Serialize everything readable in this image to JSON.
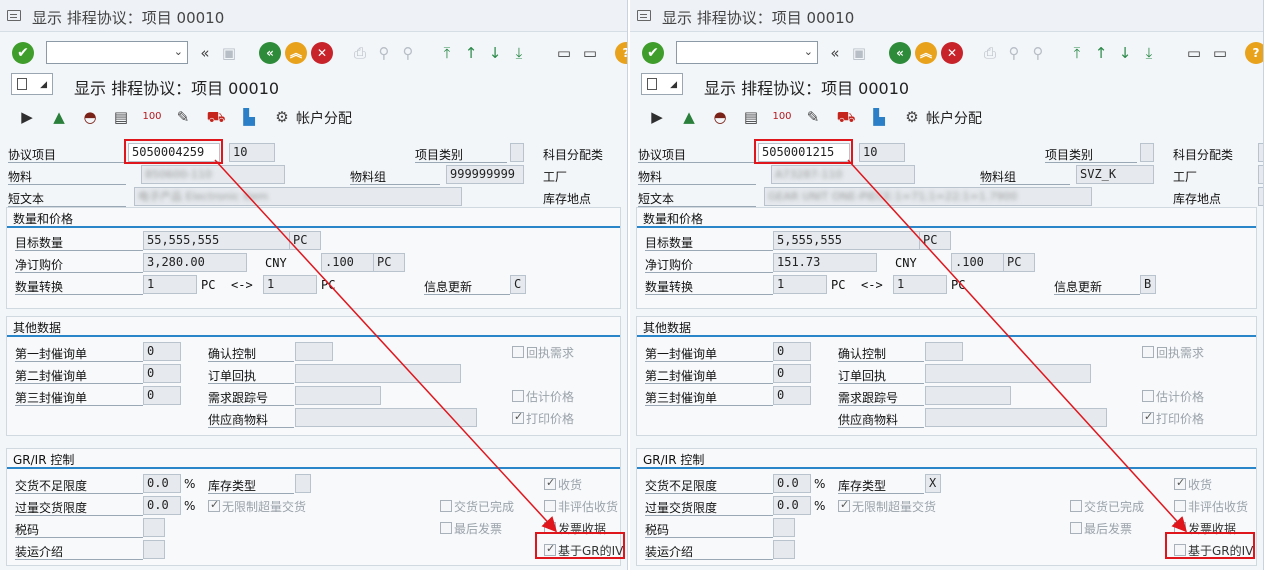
{
  "panels": [
    {
      "window_title": "显示 排程协议：项目 00010",
      "sub_title": "显示 排程协议：项目 00010",
      "account_assign": "帐户分配",
      "header": {
        "agreement_item_label": "协议项目",
        "agreement_no": "5050004259",
        "item_no": "10",
        "item_category_label": "项目类别",
        "acct_assign_cat_label": "科目分配类",
        "material_label": "物料",
        "material_value": "850600-110",
        "mat_group_label": "物料组",
        "mat_group_value": "999999999",
        "plant_label": "工厂",
        "short_text_label": "短文本",
        "short_text_value": "电子产品 Electronic Item",
        "storage_loc_label": "库存地点"
      },
      "qty": {
        "title": "数量和价格",
        "target_qty_label": "目标数量",
        "target_qty": "55,555,555",
        "target_unit": "PC",
        "net_price_label": "净订购价",
        "net_price": "3,280.00",
        "currency": "CNY",
        "per": ".100",
        "per_unit": "PC",
        "conv_label": "数量转换",
        "conv_left": "1",
        "conv_left_unit": "PC",
        "conv_arrow": "<->",
        "conv_right": "1",
        "conv_right_unit": "PC",
        "info_update_label": "信息更新",
        "info_update": "C"
      },
      "other": {
        "title": "其他数据",
        "rem1_label": "第一封催询单",
        "rem1": "0",
        "rem2_label": "第二封催询单",
        "rem2": "0",
        "rem3_label": "第三封催询单",
        "rem3": "0",
        "conf_ctrl_label": "确认控制",
        "order_ack_label": "订单回执",
        "req_track_label": "需求跟踪号",
        "vendor_mat_label": "供应商物料",
        "ack_reqd": "回执需求",
        "est_price": "估计价格",
        "print_price": "打印价格"
      },
      "grir": {
        "title": "GR/IR 控制",
        "under_label": "交货不足限度",
        "under": "0.0",
        "pct1": "%",
        "over_label": "过量交货限度",
        "over": "0.0",
        "pct2": "%",
        "stock_type_label": "库存类型",
        "stock_type": "",
        "unlimited": "无限制超量交货",
        "tax_label": "税码",
        "ship_instr_label": "装运介绍",
        "deliv_compl": "交货已完成",
        "final_inv": "最后发票",
        "gr": "收货",
        "non_val_gr": "非评估收货",
        "inv_receipt": "发票收据",
        "gr_based_iv": "基于GR的IV",
        "gr_based_iv_checked": true
      }
    },
    {
      "window_title": "显示 排程协议：项目 00010",
      "sub_title": "显示 排程协议：项目 00010",
      "account_assign": "帐户分配",
      "header": {
        "agreement_item_label": "协议项目",
        "agreement_no": "5050001215",
        "item_no": "10",
        "item_category_label": "项目类别",
        "acct_assign_cat_label": "科目分配类",
        "material_label": "物料",
        "material_value": "A73287-110",
        "mat_group_label": "物料组",
        "mat_group_value": "SVZ_K",
        "plant_label": "工厂",
        "short_text_label": "短文本",
        "short_text_value": "GEAR UNIT ONE-PIECE:1=71;1=22;1=1.7900",
        "storage_loc_label": "库存地点"
      },
      "qty": {
        "title": "数量和价格",
        "target_qty_label": "目标数量",
        "target_qty": "5,555,555",
        "target_unit": "PC",
        "net_price_label": "净订购价",
        "net_price": "151.73",
        "currency": "CNY",
        "per": ".100",
        "per_unit": "PC",
        "conv_label": "数量转换",
        "conv_left": "1",
        "conv_left_unit": "PC",
        "conv_arrow": "<->",
        "conv_right": "1",
        "conv_right_unit": "PC",
        "info_update_label": "信息更新",
        "info_update": "B"
      },
      "other": {
        "title": "其他数据",
        "rem1_label": "第一封催询单",
        "rem1": "0",
        "rem2_label": "第二封催询单",
        "rem2": "0",
        "rem3_label": "第三封催询单",
        "rem3": "0",
        "conf_ctrl_label": "确认控制",
        "order_ack_label": "订单回执",
        "req_track_label": "需求跟踪号",
        "vendor_mat_label": "供应商物料",
        "ack_reqd": "回执需求",
        "est_price": "估计价格",
        "print_price": "打印价格"
      },
      "grir": {
        "title": "GR/IR 控制",
        "under_label": "交货不足限度",
        "under": "0.0",
        "pct1": "%",
        "over_label": "过量交货限度",
        "over": "0.0",
        "pct2": "%",
        "stock_type_label": "库存类型",
        "stock_type": "X",
        "unlimited": "无限制超量交货",
        "tax_label": "税码",
        "ship_instr_label": "装运介绍",
        "deliv_compl": "交货已完成",
        "final_inv": "最后发票",
        "gr": "收货",
        "non_val_gr": "非评估收货",
        "inv_receipt": "发票收据",
        "gr_based_iv": "基于GR的IV",
        "gr_based_iv_checked": false
      }
    }
  ],
  "colors": {
    "annotation": "#e0161d",
    "group_rule": "#2a86c8"
  }
}
